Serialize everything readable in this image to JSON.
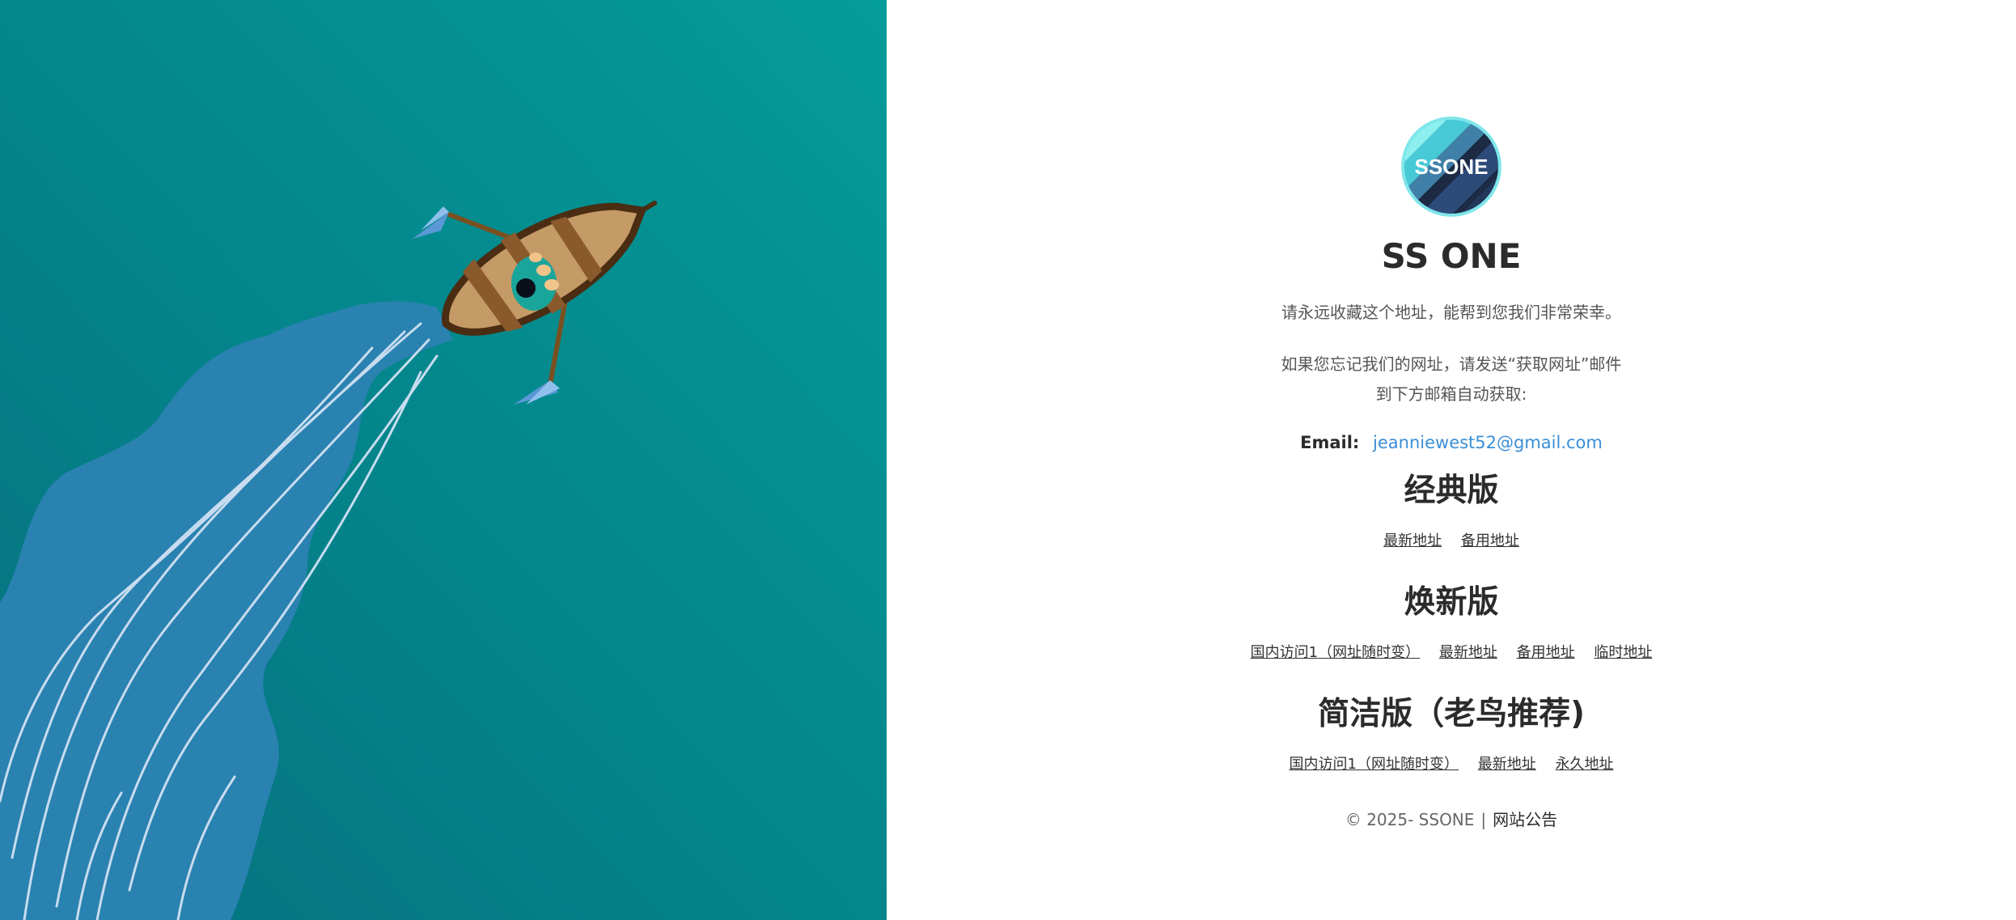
{
  "hero": {
    "illustration": "rowboat-aerial-illustration",
    "colors": {
      "sea_light": "#049c98",
      "sea_dark": "#057080",
      "wake": "#2a82b0",
      "boat": "#c49a66"
    }
  },
  "site": {
    "logo_text": "SSONE",
    "title": "SS ONE",
    "tagline": "请永远收藏这个地址，能帮到您我们非常荣幸。",
    "hint_line1": "如果您忘记我们的网址，请发送“获取网址”邮件",
    "hint_line2": "到下方邮箱自动获取:",
    "email_label": "Email:",
    "email": "jeanniewest52@gmail.com",
    "link_color": "#3a8fd6"
  },
  "classic": {
    "title": "经典版",
    "links": [
      "最新地址",
      "备用地址"
    ]
  },
  "renewed": {
    "title": "焕新版",
    "links": [
      "国内访问1（网址随时变）",
      "最新地址",
      "备用地址",
      "临时地址"
    ]
  },
  "simple": {
    "title": "简洁版（老鸟推荐)",
    "links": [
      "国内访问1（网址随时变）",
      "最新地址",
      "永久地址"
    ]
  },
  "footer": {
    "copyright": "© 2025- SSONE",
    "separator": "|",
    "announcement": "网站公告"
  }
}
